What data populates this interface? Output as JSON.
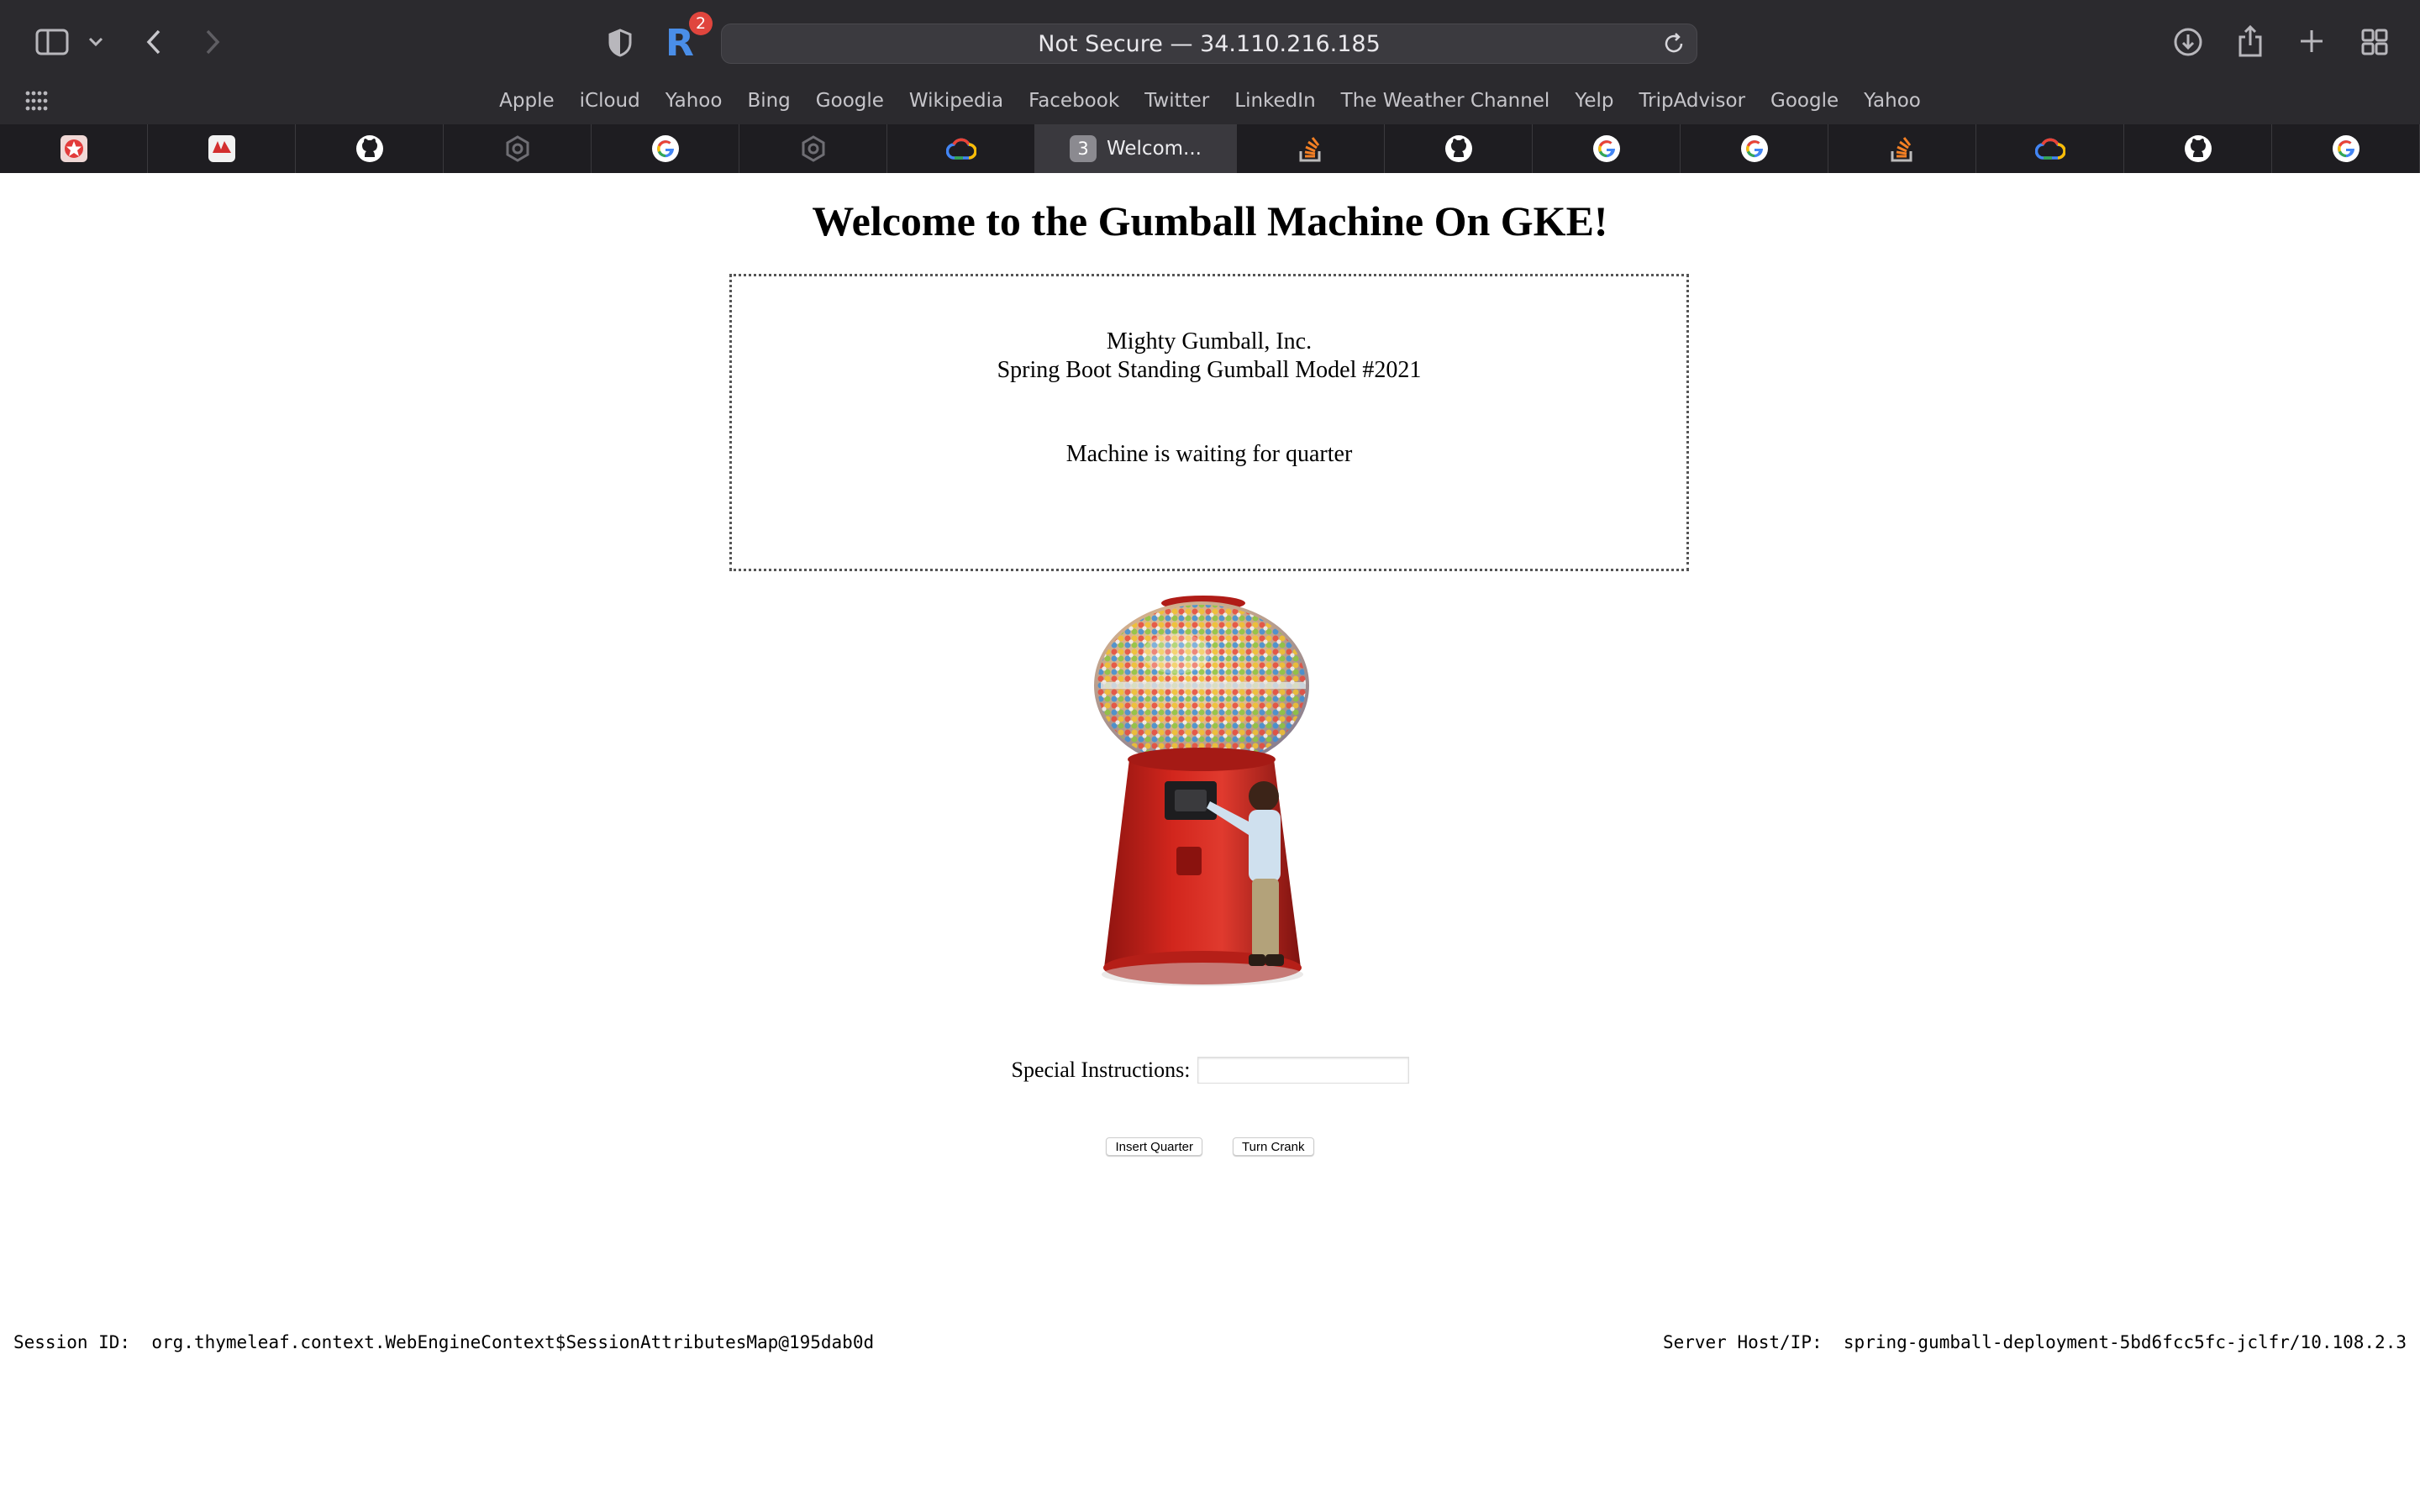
{
  "browser": {
    "address": "Not Secure — 34.110.216.185",
    "extension_badge": "2",
    "favorites": [
      "Apple",
      "iCloud",
      "Yahoo",
      "Bing",
      "Google",
      "Wikipedia",
      "Facebook",
      "Twitter",
      "LinkedIn",
      "The Weather Channel",
      "Yelp",
      "TripAdvisor",
      "Google",
      "Yahoo"
    ],
    "tabs": [
      {
        "icon": "red-star-icon",
        "color": "#e23b3b"
      },
      {
        "icon": "red-logo-icon",
        "color": "#d32f2f"
      },
      {
        "icon": "github-icon",
        "color": "#ffffff"
      },
      {
        "icon": "hexagon-icon",
        "color": "#6f6e74"
      },
      {
        "icon": "google-icon",
        "color": "#4285f4"
      },
      {
        "icon": "hexagon-icon",
        "color": "#6f6e74"
      },
      {
        "icon": "google-cloud-icon",
        "color": "#4285f4"
      },
      {
        "icon": "tab-number-icon",
        "number": "3",
        "title": "Welcom...",
        "active": true
      },
      {
        "icon": "stackoverflow-icon",
        "color": "#f48024"
      },
      {
        "icon": "github-icon",
        "color": "#ffffff"
      },
      {
        "icon": "google-icon",
        "color": "#4285f4"
      },
      {
        "icon": "google-icon",
        "color": "#4285f4"
      },
      {
        "icon": "stackoverflow-icon",
        "color": "#f48024"
      },
      {
        "icon": "google-cloud-icon",
        "color": "#4285f4"
      },
      {
        "icon": "github-icon",
        "color": "#ffffff"
      },
      {
        "icon": "google-icon",
        "color": "#4285f4"
      }
    ]
  },
  "page": {
    "title": "Welcome to the Gumball Machine On GKE!",
    "company": "Mighty Gumball, Inc.",
    "model": "Spring Boot Standing Gumball Model #2021",
    "state": "Machine is waiting for quarter",
    "special_label": "Special Instructions:",
    "special_value": "",
    "insert_button": "Insert Quarter",
    "crank_button": "Turn Crank",
    "session_label": "Session ID:",
    "session_value": "org.thymeleaf.context.WebEngineContext$SessionAttributesMap@195dab0d",
    "server_label": "Server Host/IP:",
    "server_value": "spring-gumball-deployment-5bd6fcc5fc-jclfr/10.108.2.3"
  }
}
